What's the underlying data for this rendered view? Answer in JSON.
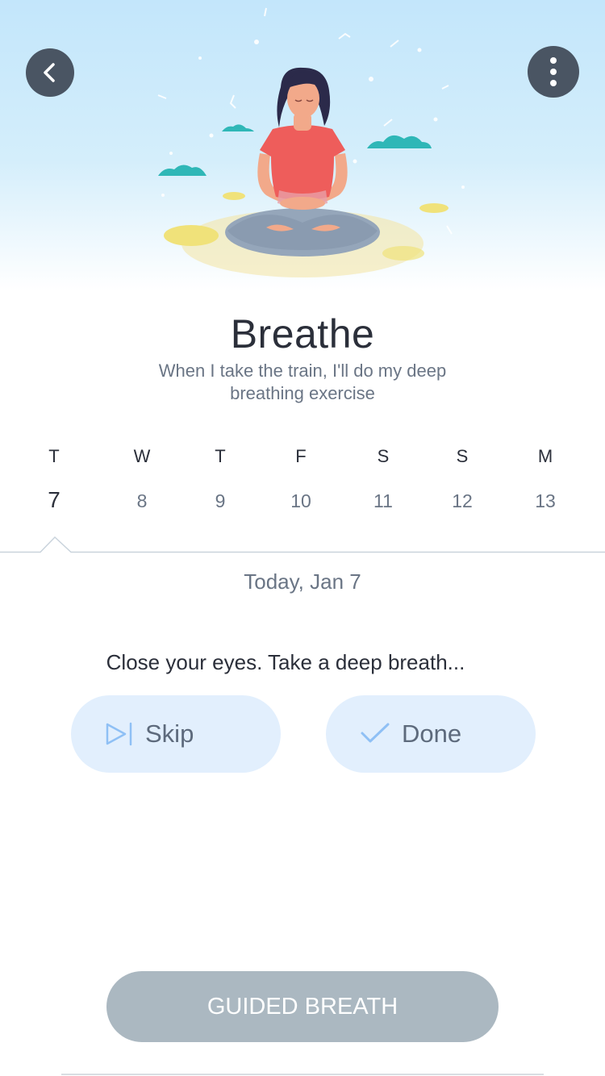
{
  "header": {
    "back_icon": "chevron-left-icon",
    "more_icon": "more-vertical-icon"
  },
  "habit": {
    "title": "Breathe",
    "description": "When I take the train, I'll do my deep breathing exercise"
  },
  "week": [
    {
      "dow": "T",
      "date": "7",
      "today": true
    },
    {
      "dow": "W",
      "date": "8",
      "today": false
    },
    {
      "dow": "T",
      "date": "9",
      "today": false
    },
    {
      "dow": "F",
      "date": "10",
      "today": false
    },
    {
      "dow": "S",
      "date": "11",
      "today": false
    },
    {
      "dow": "S",
      "date": "12",
      "today": false
    },
    {
      "dow": "M",
      "date": "13",
      "today": false
    }
  ],
  "selected_date_label": "Today, Jan 7",
  "prompt": "Close your eyes. Take a deep breath...",
  "actions": {
    "skip_label": "Skip",
    "done_label": "Done"
  },
  "guided_button": "GUIDED BREATH",
  "colors": {
    "accent": "#8fc0f5",
    "pill_bg": "#e2effd",
    "header_btn": "#4a5563",
    "guided_btn": "#abb8c1"
  }
}
